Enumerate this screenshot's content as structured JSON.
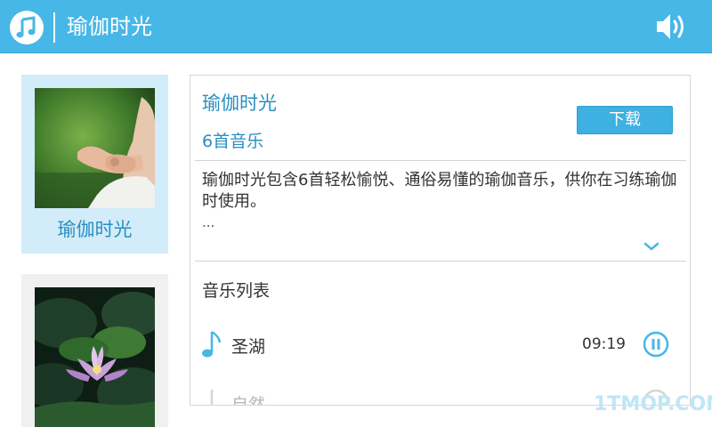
{
  "header": {
    "app_icon": "music-note-icon",
    "title": "瑜伽时光",
    "volume_icon": "speaker-volume-icon",
    "bar_color": "#46b7e6"
  },
  "albums": [
    {
      "name": "瑜伽时光",
      "cover": "meditation-hands-photo",
      "selected": true
    },
    {
      "name": "",
      "cover": "lotus-flower-photo",
      "selected": false
    }
  ],
  "detail": {
    "title": "瑜伽时光",
    "count": "6首音乐",
    "download_label": "下载",
    "description": "瑜伽时光包含6首轻松愉悦、通俗易懂的瑜伽音乐，供你在习练瑜伽时使用。",
    "ellipsis": "...",
    "expand_icon": "chevron-down-icon",
    "list_title": "音乐列表",
    "tracks": [
      {
        "name": "圣湖",
        "duration": "09:19",
        "icon": "music-note-icon",
        "action_icon": "pause-circle-icon"
      },
      {
        "name": "自然",
        "duration": "",
        "icon": "music-note-icon",
        "action_icon": "play-circle-icon"
      }
    ]
  },
  "watermark": "1TMOP.COM",
  "accent_color": "#2a8fc1"
}
